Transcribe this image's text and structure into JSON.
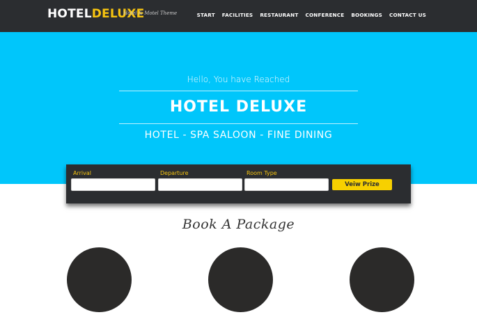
{
  "header": {
    "logo_part1": "HOTEL",
    "logo_part2": "DELUXE",
    "tagline": "Hotel & Motel Theme",
    "nav": [
      "START",
      "FACILITIES",
      "RESTAURANT",
      "CONFERENCE",
      "BOOKINGS",
      "CONTACT US"
    ]
  },
  "hero": {
    "greeting": "Hello, You have Reached",
    "title": "HOTEL DELUXE",
    "subtitle": "HOTEL - SPA SALOON - FINE DINING"
  },
  "booking": {
    "arrival_label": "Arrival",
    "arrival_value": "",
    "departure_label": "Departure",
    "departure_value": "",
    "room_type_label": "Room Type",
    "room_type_value": "",
    "button_label": "Veiw Prize"
  },
  "packages": {
    "title": "Book A Package"
  },
  "colors": {
    "header_bg": "#2b2d30",
    "hero_bg": "#00c6fb",
    "accent": "#f7c410",
    "button_bg": "#f7d000",
    "circle": "#2b2a29"
  }
}
